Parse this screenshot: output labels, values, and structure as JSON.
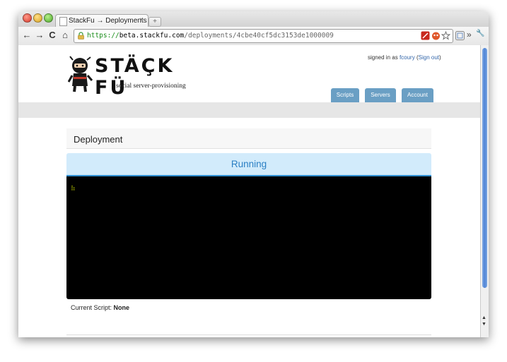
{
  "browser": {
    "tab_title": "StackFu → Deployments",
    "tab_close": "×",
    "new_tab": "+",
    "url_scheme": "https://",
    "url_host": "beta.stackfu.com",
    "url_path": "/deployments/4cbe40cf5dc3153de1000009",
    "nav": {
      "back": "←",
      "forward": "→",
      "reload": "C",
      "home": "⌂"
    },
    "more": "»",
    "wrench": "🔧",
    "colors": {
      "secure": "#1a8d1a",
      "thumb": "#4f84d6"
    }
  },
  "site": {
    "logo_text": "STÄÇK FÜ",
    "logo_tagline": "social server-provisioning",
    "signin_prefix": "signed in as",
    "username": "fcoury",
    "signout_open": "(",
    "signout": "Sign out",
    "signout_close": ")",
    "nav": [
      "Scripts",
      "Servers",
      "Account"
    ]
  },
  "deployment": {
    "heading": "Deployment",
    "status": "Running",
    "spinner": "⠷",
    "current_script_label": "Current Script:",
    "current_script_value": "None"
  }
}
